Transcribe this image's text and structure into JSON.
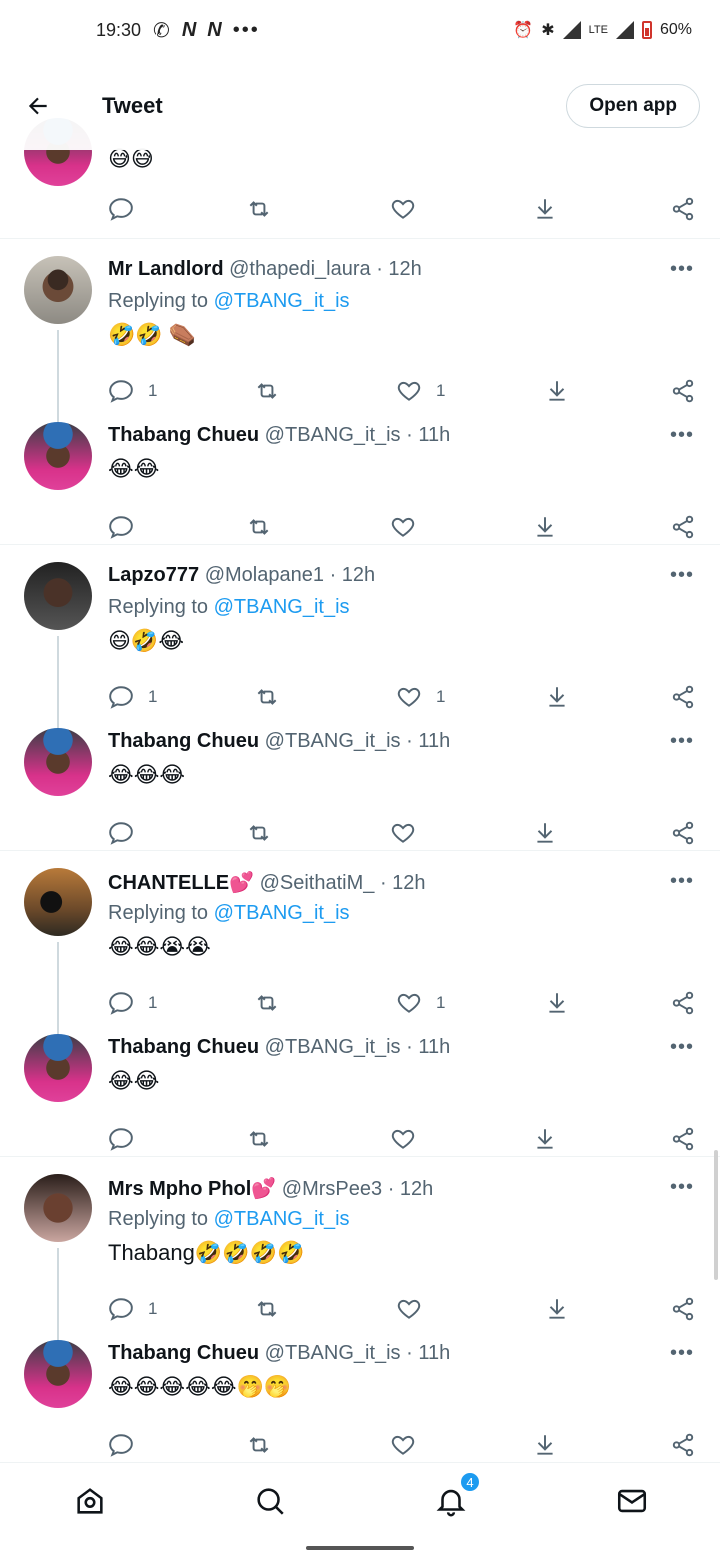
{
  "status_bar": {
    "time": "19:30",
    "carrier_icons": [
      "whatsapp-icon",
      "n-icon",
      "n-icon",
      "more-dots-icon"
    ],
    "network": "LTE",
    "battery": "60%",
    "notification_dots": "•••"
  },
  "top_bar": {
    "title": "Tweet",
    "open_app_label": "Open app"
  },
  "partial_tweet": {
    "body": "😅😅"
  },
  "tweets": [
    {
      "name": "Mr Landlord",
      "handle": "@thapedi_laura",
      "time": "· 12h",
      "replying_prefix": "Replying to",
      "replying_to": "@TBANG_it_is",
      "body": "🤣🤣 ⚰️",
      "reply_count": "1",
      "like_count": "1"
    },
    {
      "name": "Thabang Chueu",
      "handle": "@TBANG_it_is",
      "time": "· 11h",
      "body": "😂😂",
      "reply_count": "",
      "like_count": ""
    },
    {
      "name": "Lapzo777",
      "handle": "@Molapane1",
      "time": "· 12h",
      "replying_prefix": "Replying to",
      "replying_to": "@TBANG_it_is",
      "body": "😄🤣😂",
      "reply_count": "1",
      "like_count": "1"
    },
    {
      "name": "Thabang Chueu",
      "handle": "@TBANG_it_is",
      "time": "· 11h",
      "body": "😂😂😂",
      "reply_count": "",
      "like_count": ""
    },
    {
      "name": "CHANTELLE💕",
      "handle": "@SeithatiM_",
      "time": "· 12h",
      "replying_prefix": "Replying to",
      "replying_to": "@TBANG_it_is",
      "body": "😂😂😭😭",
      "reply_count": "1",
      "like_count": "1"
    },
    {
      "name": "Thabang Chueu",
      "handle": "@TBANG_it_is",
      "time": "· 11h",
      "body": "😂😂",
      "reply_count": "",
      "like_count": ""
    },
    {
      "name": "Mrs Mpho Phol💕",
      "handle": "@MrsPee3",
      "time": "· 12h",
      "replying_prefix": "Replying to",
      "replying_to": "@TBANG_it_is",
      "body": "Thabang🤣🤣🤣🤣",
      "reply_count": "1",
      "like_count": ""
    },
    {
      "name": "Thabang Chueu",
      "handle": "@TBANG_it_is",
      "time": "· 11h",
      "body": "😂😂😂😂😂🤭🤭",
      "reply_count": "",
      "like_count": ""
    }
  ],
  "bottom_nav": {
    "items": [
      "home-icon",
      "search-icon",
      "notifications-icon",
      "messages-icon"
    ],
    "notification_badge": "4"
  }
}
